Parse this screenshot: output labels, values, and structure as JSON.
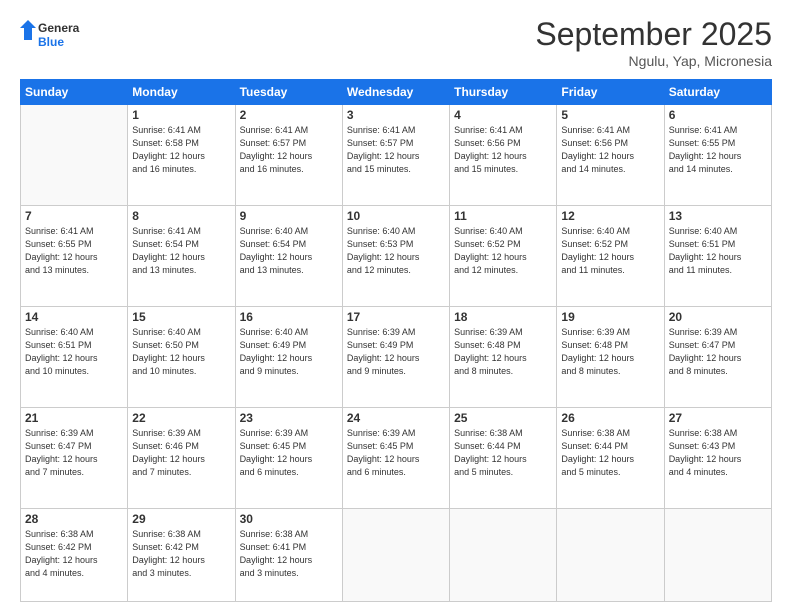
{
  "header": {
    "logo_general": "General",
    "logo_blue": "Blue",
    "month_title": "September 2025",
    "subtitle": "Ngulu, Yap, Micronesia"
  },
  "weekdays": [
    "Sunday",
    "Monday",
    "Tuesday",
    "Wednesday",
    "Thursday",
    "Friday",
    "Saturday"
  ],
  "weeks": [
    [
      {
        "day": "",
        "info": ""
      },
      {
        "day": "1",
        "info": "Sunrise: 6:41 AM\nSunset: 6:58 PM\nDaylight: 12 hours\nand 16 minutes."
      },
      {
        "day": "2",
        "info": "Sunrise: 6:41 AM\nSunset: 6:57 PM\nDaylight: 12 hours\nand 16 minutes."
      },
      {
        "day": "3",
        "info": "Sunrise: 6:41 AM\nSunset: 6:57 PM\nDaylight: 12 hours\nand 15 minutes."
      },
      {
        "day": "4",
        "info": "Sunrise: 6:41 AM\nSunset: 6:56 PM\nDaylight: 12 hours\nand 15 minutes."
      },
      {
        "day": "5",
        "info": "Sunrise: 6:41 AM\nSunset: 6:56 PM\nDaylight: 12 hours\nand 14 minutes."
      },
      {
        "day": "6",
        "info": "Sunrise: 6:41 AM\nSunset: 6:55 PM\nDaylight: 12 hours\nand 14 minutes."
      }
    ],
    [
      {
        "day": "7",
        "info": "Sunrise: 6:41 AM\nSunset: 6:55 PM\nDaylight: 12 hours\nand 13 minutes."
      },
      {
        "day": "8",
        "info": "Sunrise: 6:41 AM\nSunset: 6:54 PM\nDaylight: 12 hours\nand 13 minutes."
      },
      {
        "day": "9",
        "info": "Sunrise: 6:40 AM\nSunset: 6:54 PM\nDaylight: 12 hours\nand 13 minutes."
      },
      {
        "day": "10",
        "info": "Sunrise: 6:40 AM\nSunset: 6:53 PM\nDaylight: 12 hours\nand 12 minutes."
      },
      {
        "day": "11",
        "info": "Sunrise: 6:40 AM\nSunset: 6:52 PM\nDaylight: 12 hours\nand 12 minutes."
      },
      {
        "day": "12",
        "info": "Sunrise: 6:40 AM\nSunset: 6:52 PM\nDaylight: 12 hours\nand 11 minutes."
      },
      {
        "day": "13",
        "info": "Sunrise: 6:40 AM\nSunset: 6:51 PM\nDaylight: 12 hours\nand 11 minutes."
      }
    ],
    [
      {
        "day": "14",
        "info": "Sunrise: 6:40 AM\nSunset: 6:51 PM\nDaylight: 12 hours\nand 10 minutes."
      },
      {
        "day": "15",
        "info": "Sunrise: 6:40 AM\nSunset: 6:50 PM\nDaylight: 12 hours\nand 10 minutes."
      },
      {
        "day": "16",
        "info": "Sunrise: 6:40 AM\nSunset: 6:49 PM\nDaylight: 12 hours\nand 9 minutes."
      },
      {
        "day": "17",
        "info": "Sunrise: 6:39 AM\nSunset: 6:49 PM\nDaylight: 12 hours\nand 9 minutes."
      },
      {
        "day": "18",
        "info": "Sunrise: 6:39 AM\nSunset: 6:48 PM\nDaylight: 12 hours\nand 8 minutes."
      },
      {
        "day": "19",
        "info": "Sunrise: 6:39 AM\nSunset: 6:48 PM\nDaylight: 12 hours\nand 8 minutes."
      },
      {
        "day": "20",
        "info": "Sunrise: 6:39 AM\nSunset: 6:47 PM\nDaylight: 12 hours\nand 8 minutes."
      }
    ],
    [
      {
        "day": "21",
        "info": "Sunrise: 6:39 AM\nSunset: 6:47 PM\nDaylight: 12 hours\nand 7 minutes."
      },
      {
        "day": "22",
        "info": "Sunrise: 6:39 AM\nSunset: 6:46 PM\nDaylight: 12 hours\nand 7 minutes."
      },
      {
        "day": "23",
        "info": "Sunrise: 6:39 AM\nSunset: 6:45 PM\nDaylight: 12 hours\nand 6 minutes."
      },
      {
        "day": "24",
        "info": "Sunrise: 6:39 AM\nSunset: 6:45 PM\nDaylight: 12 hours\nand 6 minutes."
      },
      {
        "day": "25",
        "info": "Sunrise: 6:38 AM\nSunset: 6:44 PM\nDaylight: 12 hours\nand 5 minutes."
      },
      {
        "day": "26",
        "info": "Sunrise: 6:38 AM\nSunset: 6:44 PM\nDaylight: 12 hours\nand 5 minutes."
      },
      {
        "day": "27",
        "info": "Sunrise: 6:38 AM\nSunset: 6:43 PM\nDaylight: 12 hours\nand 4 minutes."
      }
    ],
    [
      {
        "day": "28",
        "info": "Sunrise: 6:38 AM\nSunset: 6:42 PM\nDaylight: 12 hours\nand 4 minutes."
      },
      {
        "day": "29",
        "info": "Sunrise: 6:38 AM\nSunset: 6:42 PM\nDaylight: 12 hours\nand 3 minutes."
      },
      {
        "day": "30",
        "info": "Sunrise: 6:38 AM\nSunset: 6:41 PM\nDaylight: 12 hours\nand 3 minutes."
      },
      {
        "day": "",
        "info": ""
      },
      {
        "day": "",
        "info": ""
      },
      {
        "day": "",
        "info": ""
      },
      {
        "day": "",
        "info": ""
      }
    ]
  ]
}
